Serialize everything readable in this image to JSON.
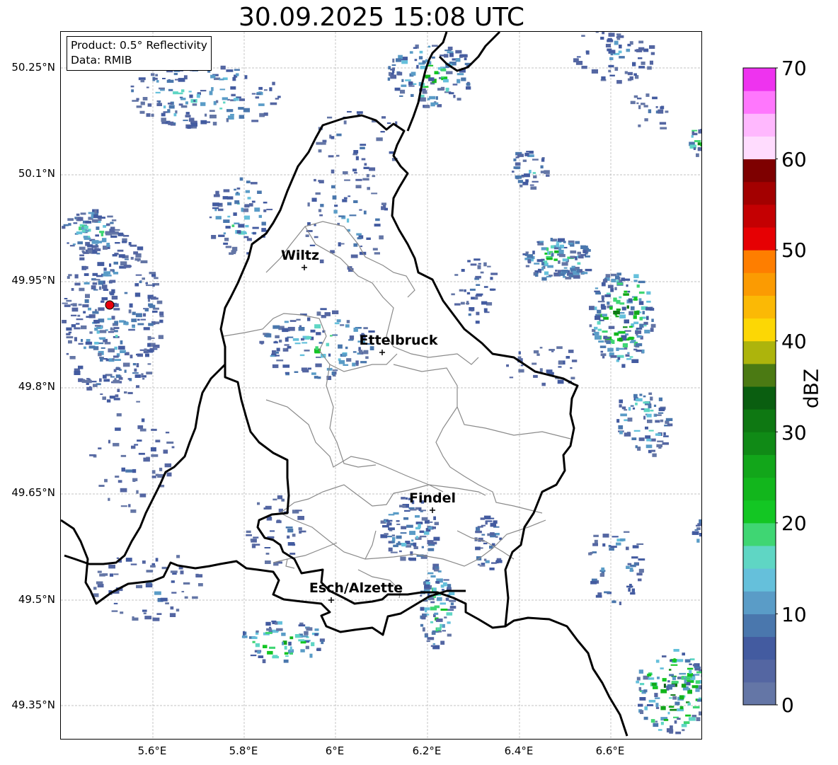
{
  "title": "30.09.2025 15:08 UTC",
  "info": {
    "product": "Product: 0.5° Reflectivity",
    "data": "Data: RMIB"
  },
  "axes": {
    "lat_ticks": [
      "50.25°N",
      "50.1°N",
      "49.95°N",
      "49.8°N",
      "49.65°N",
      "49.5°N",
      "49.35°N"
    ],
    "lon_ticks": [
      "5.6°E",
      "5.8°E",
      "6°E",
      "6.2°E",
      "6.4°E",
      "6.6°E"
    ],
    "gridlines": true
  },
  "cities": [
    {
      "name": "Wiltz"
    },
    {
      "name": "Ettelbruck"
    },
    {
      "name": "Findel"
    },
    {
      "name": "Esch/Alzette"
    }
  ],
  "radar_site_color": "#e8000b",
  "colorbar": {
    "label": "dBZ",
    "tick_labels": [
      "0",
      "10",
      "20",
      "30",
      "40",
      "50",
      "60",
      "70"
    ],
    "range": [
      0,
      70
    ],
    "bin_step": 2.5,
    "colors": [
      "#6476a6",
      "#5466a2",
      "#435ba0",
      "#4a77ad",
      "#5a9cc7",
      "#65c0db",
      "#5fd6c4",
      "#3fd673",
      "#13c623",
      "#12b61c",
      "#12a61a",
      "#108a16",
      "#0e7812",
      "#0a5e10",
      "#4b7a13",
      "#adb40c",
      "#fcd705",
      "#fbb905",
      "#fb9b02",
      "#fe7e00",
      "#e60003",
      "#c40002",
      "#a30000",
      "#7e0000",
      "#ffdcfe",
      "#ffb8fe",
      "#ff77fd",
      "#ee33ef"
    ]
  }
}
